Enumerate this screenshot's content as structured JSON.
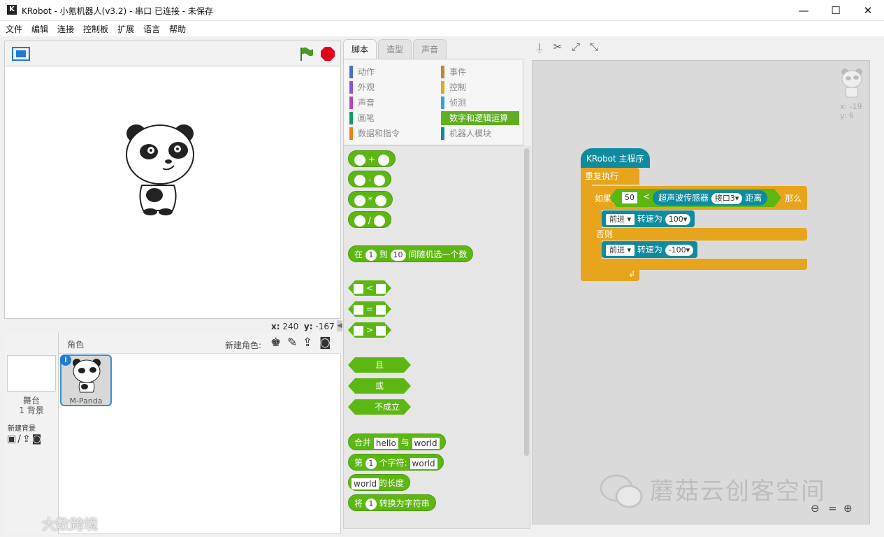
{
  "window": {
    "title": "KRobot - 小氪机器人(v3.2) - 串口 已连接 - 未保存",
    "minimize": "—",
    "maximize": "☐",
    "close": "✕"
  },
  "menu": [
    "文件",
    "编辑",
    "连接",
    "控制板",
    "扩展",
    "语言",
    "帮助"
  ],
  "stage": {
    "coords_x_label": "x:",
    "coords_x": "240",
    "coords_y_label": "y:",
    "coords_y": "-167"
  },
  "sprites": {
    "header_label": "角色",
    "new_sprite_label": "新建角色:",
    "stage_label": "舞台",
    "backdrop_count": "1 背景",
    "new_backdrop_label": "新建背景",
    "sprite_name": "M-Panda"
  },
  "tabs": [
    "脚本",
    "造型",
    "声音"
  ],
  "categories": {
    "left": [
      {
        "label": "动作",
        "color": "#4a6cd4"
      },
      {
        "label": "外观",
        "color": "#8a55d7"
      },
      {
        "label": "声音",
        "color": "#bb42c3"
      },
      {
        "label": "画笔",
        "color": "#0e9a6c"
      },
      {
        "label": "数据和指令",
        "color": "#ee7d16"
      }
    ],
    "right": [
      {
        "label": "事件",
        "color": "#c88330"
      },
      {
        "label": "控制",
        "color": "#e1a91a"
      },
      {
        "label": "侦测",
        "color": "#2ca5e2"
      },
      {
        "label": "数字和逻辑运算",
        "color": "#5cb712"
      },
      {
        "label": "机器人模块",
        "color": "#0e8b9e"
      }
    ]
  },
  "palette": {
    "ops": [
      "+",
      "-",
      "*",
      "/"
    ],
    "random": {
      "a": "在",
      "from": "1",
      "b": "到",
      "to": "10",
      "c": "间随机选一个数"
    },
    "compare": [
      "<",
      "=",
      ">"
    ],
    "logic": [
      "且",
      "或",
      "不成立"
    ],
    "join": {
      "a": "合并",
      "s1": "hello",
      "b": "与",
      "s2": "world"
    },
    "letter": {
      "a": "第",
      "n": "1",
      "b": "个字符:",
      "s": "world"
    },
    "length": {
      "s": "world",
      "a": "的长度"
    },
    "tostring": {
      "a": "将",
      "n": "1",
      "b": "转换为字符串"
    }
  },
  "script": {
    "coords_x": "x: -19",
    "coords_y": "y: 6",
    "hat": "KRobot 主程序",
    "forever": "重复执行",
    "if_label": "如果",
    "if_value": "50",
    "if_op": "<",
    "sensor_label": "超声波传感器",
    "port": "接口3",
    "distance_label": "距离",
    "then_label": "那么",
    "cmd1_dir": "前进",
    "cmd_speed_label": "转速为",
    "cmd1_speed": "100",
    "else_label": "否则",
    "cmd2_dir": "前进",
    "cmd2_speed": "-100"
  },
  "watermark": "蘑菇云创客空间",
  "watermark_left": "大数跨境"
}
